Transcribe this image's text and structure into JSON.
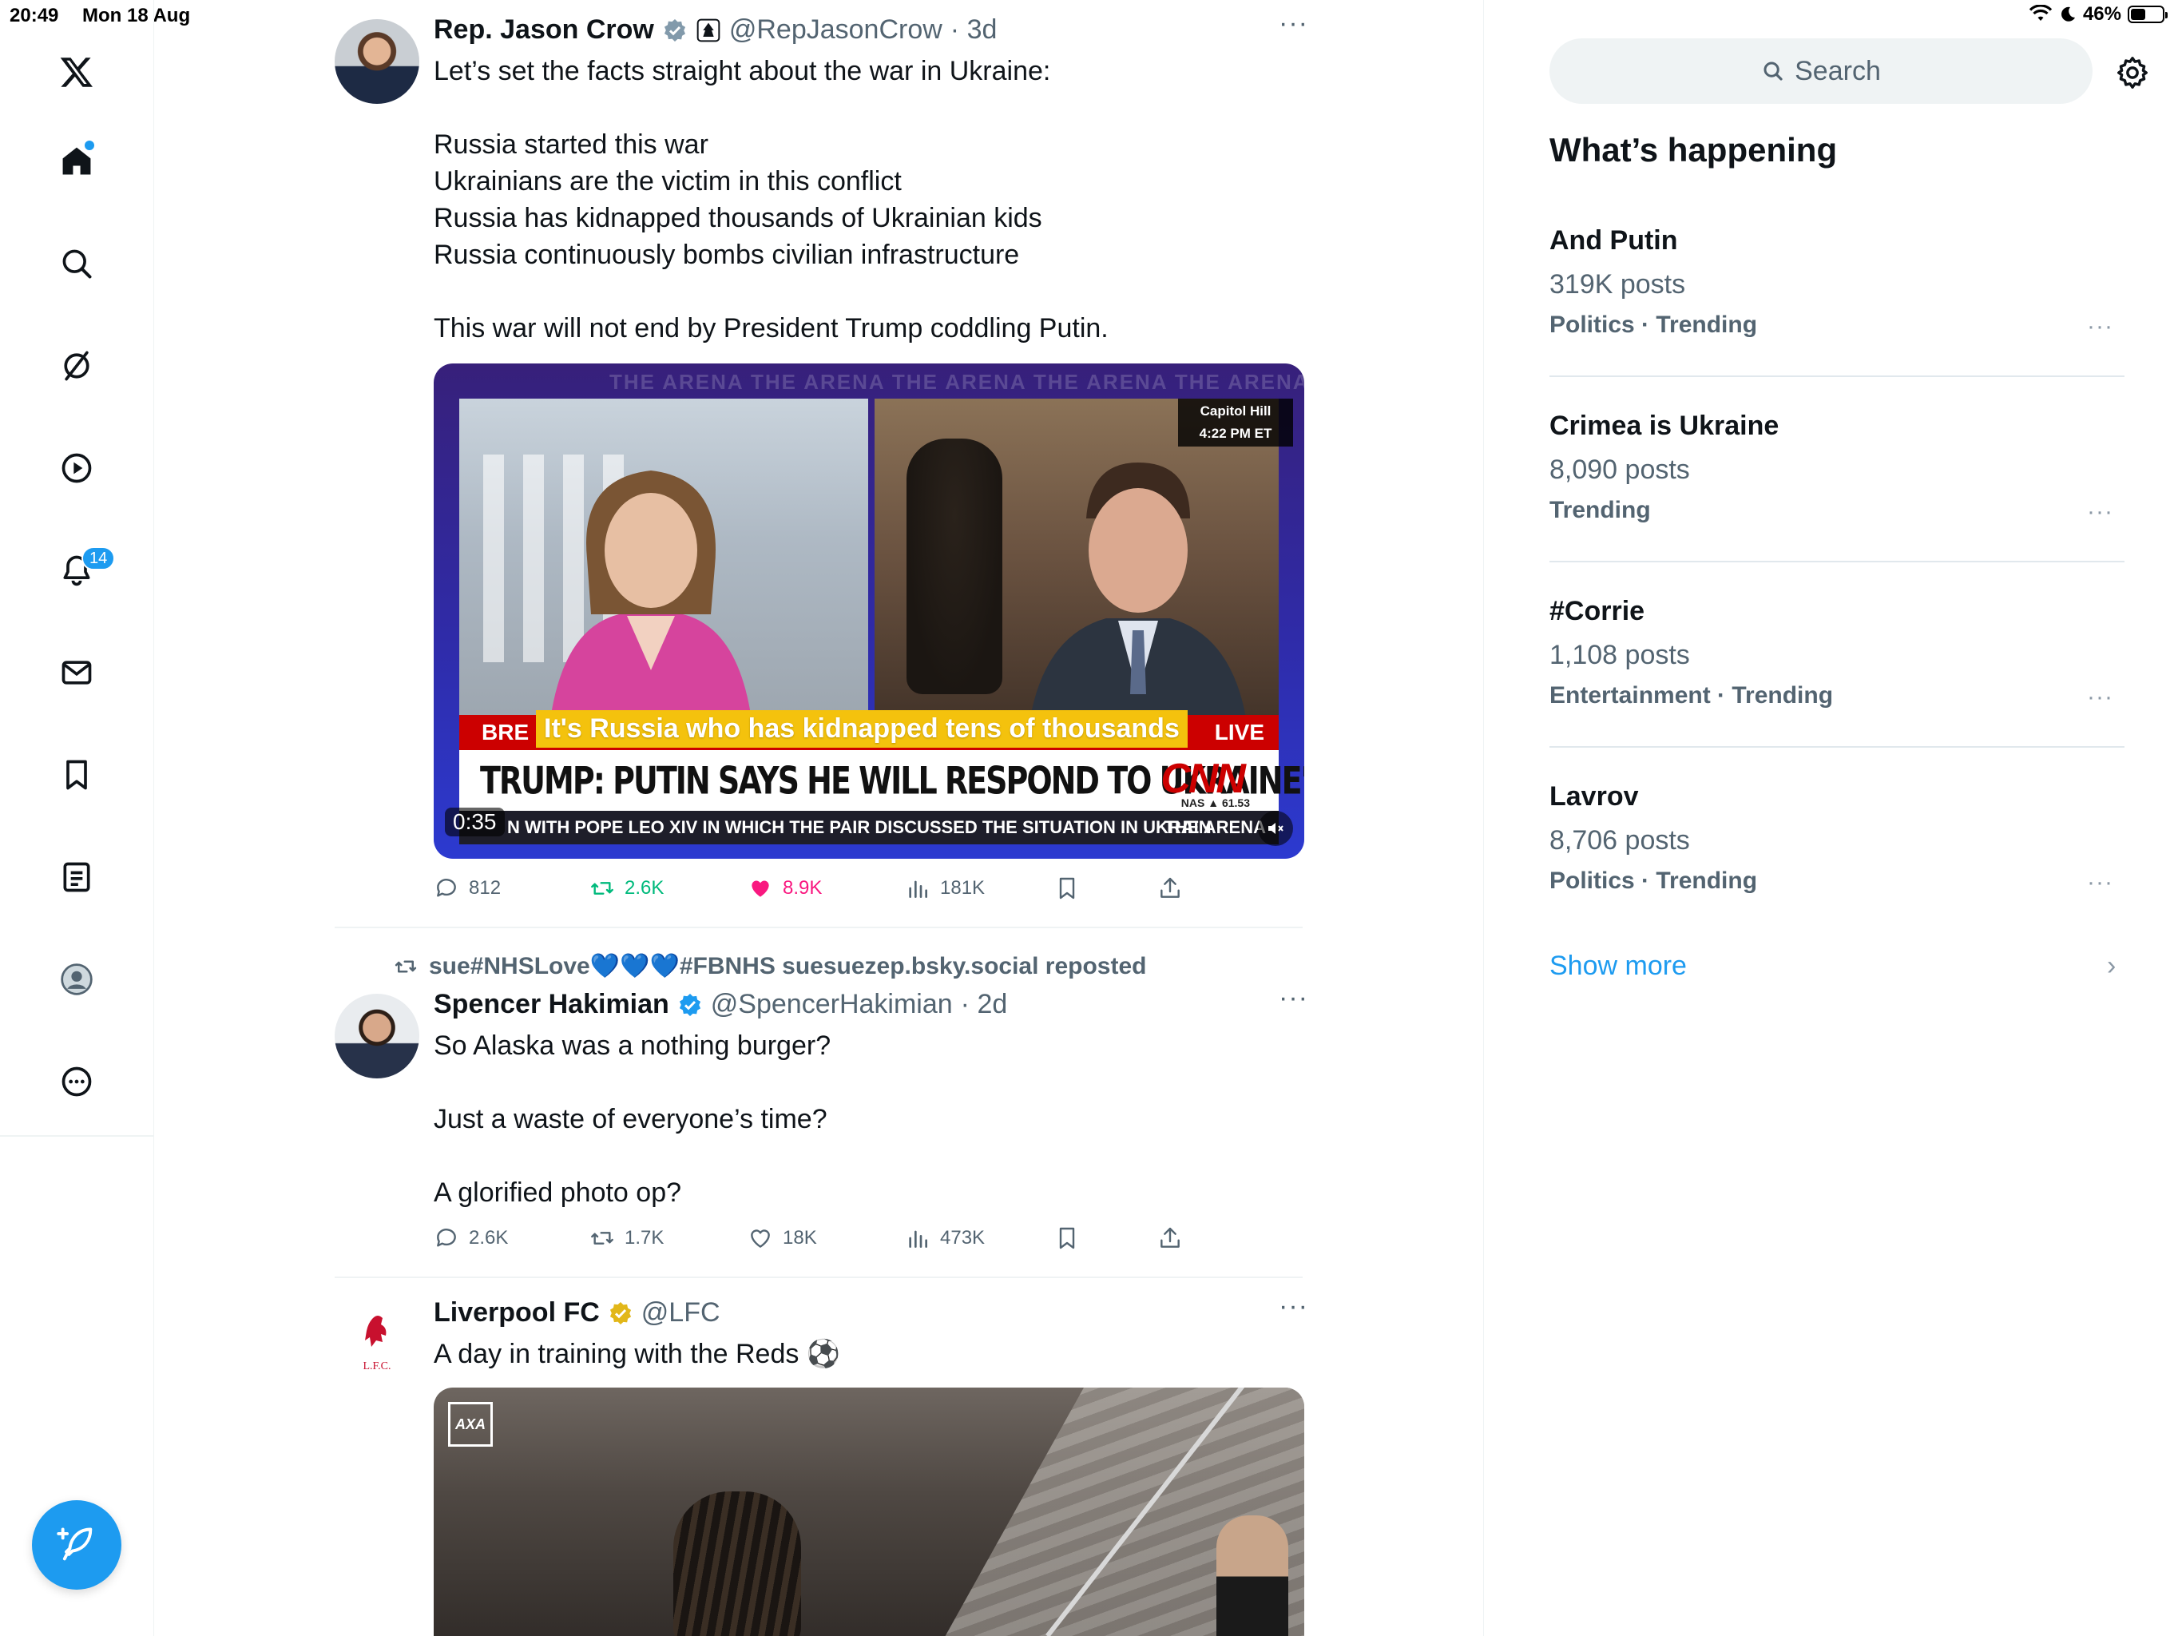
{
  "status": {
    "time": "20:49",
    "date": "Mon 18 Aug",
    "battery": "46%"
  },
  "nav": {
    "notifications_count": "14",
    "items": [
      "home-icon",
      "explore-icon",
      "grok-icon",
      "video-icon",
      "notifications-icon",
      "messages-icon",
      "bookmarks-icon",
      "lists-icon",
      "profile-icon",
      "more-icon"
    ]
  },
  "tweet1": {
    "name": "Rep. Jason Crow",
    "handle": "@RepJasonCrow",
    "time": "· 3d",
    "text": "Let’s set the facts straight about the war in Ukraine:\n\nRussia started this war\nUkrainians are the victim in this conflict\nRussia has kidnapped thousands of Ukrainian kids\nRussia continuously bombs civilian infrastructure\n\nThis war will not end by President Trump coddling Putin.",
    "video": {
      "arena_watermark": "THE ARENA   THE ARENA   THE ARENA   THE ARENA   THE ARENA",
      "location": "Capitol Hill",
      "clock": "4:22 PM ET",
      "breaking_left": "BRE",
      "breaking_right": "LIVE",
      "subtitle": "It's Russia who has kidnapped tens of thousands",
      "headline": "TRUMP: PUTIN SAYS HE WILL RESPOND TO UKRAINE'S DRONE ATTACKS",
      "network": "CNN",
      "market": "NAS ▲ 61.53",
      "ticker": "N WITH POPE LEO XIV IN WHICH THE PAIR DISCUSSED THE SITUATION IN UKRAIN",
      "ticker_brand": "THE ARENA",
      "duration": "0:35"
    },
    "replies": "812",
    "reposts": "2.6K",
    "likes": "8.9K",
    "views": "181K"
  },
  "tweet2": {
    "repost_by": "sue#NHSLove",
    "repost_tail": "#FBNHS suesuezep.bsky.social reposted",
    "hearts": "💙💙💙",
    "name": "Spencer Hakimian",
    "handle": "@SpencerHakimian",
    "time": "· 2d",
    "text": "So Alaska was a nothing burger?\n\nJust a waste of everyone’s time?\n\nA glorified photo op?",
    "replies": "2.6K",
    "reposts": "1.7K",
    "likes": "18K",
    "views": "473K"
  },
  "tweet3": {
    "name": "Liverpool FC",
    "handle": "@LFC",
    "text": "A day in training with the Reds ⚽",
    "avatar_text": "L.F.C.",
    "sponsor": "AXA"
  },
  "sidebar": {
    "search_placeholder": "Search",
    "title": "What’s happening",
    "trends": [
      {
        "name": "And Putin",
        "count": "319K posts",
        "category": "Politics · Trending"
      },
      {
        "name": "Crimea is Ukraine",
        "count": "8,090 posts",
        "category": "Trending"
      },
      {
        "name": "#Corrie",
        "count": "1,108 posts",
        "category": "Entertainment · Trending"
      },
      {
        "name": "Lavrov",
        "count": "8,706 posts",
        "category": "Politics · Trending"
      }
    ],
    "show_more": "Show more",
    "more_dots": "···"
  },
  "colors": {
    "accent": "#1d9bf0",
    "repost_green": "#00ba7c",
    "like_pink": "#f91880",
    "cnn_red": "#cc0000",
    "subtitle_yellow": "#f4c20d"
  }
}
